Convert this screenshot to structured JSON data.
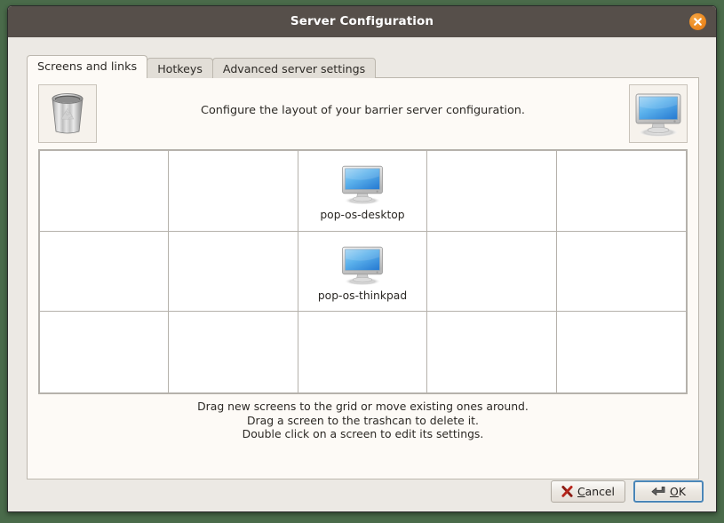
{
  "window": {
    "title": "Server Configuration",
    "close_icon": "close-icon"
  },
  "tabs": [
    {
      "label": "Screens and links",
      "active": true
    },
    {
      "label": "Hotkeys",
      "active": false
    },
    {
      "label": "Advanced server settings",
      "active": false
    }
  ],
  "header": {
    "description": "Configure the layout of your barrier server configuration.",
    "trash_icon": "trashcan-icon",
    "new_screen_icon": "monitor-icon"
  },
  "grid": {
    "columns": 5,
    "rows": 3,
    "screens": [
      {
        "row": 0,
        "col": 2,
        "name": "pop-os-desktop",
        "icon": "monitor-icon"
      },
      {
        "row": 1,
        "col": 2,
        "name": "pop-os-thinkpad",
        "icon": "monitor-icon"
      }
    ]
  },
  "hints": {
    "line1": "Drag new screens to the grid or move existing ones around.",
    "line2": "Drag a screen to the trashcan to delete it.",
    "line3": "Double click on a screen to edit its settings."
  },
  "buttons": {
    "cancel": {
      "label_pre": "",
      "label_accel": "C",
      "label_post": "ancel",
      "icon": "cancel-x-icon"
    },
    "ok": {
      "label_accel": "O",
      "label_post": "K",
      "icon": "enter-arrow-icon"
    }
  },
  "colors": {
    "desktop": "#4a6b4a",
    "titlebar": "#564f4a",
    "close_button": "#ed8b22",
    "dialog_bg": "#ece9e4",
    "panel_bg": "#fdfaf6",
    "grid_line": "#b5b1ab",
    "focus_border": "#4a86b8",
    "screen_blue": "#3c9ae8"
  }
}
